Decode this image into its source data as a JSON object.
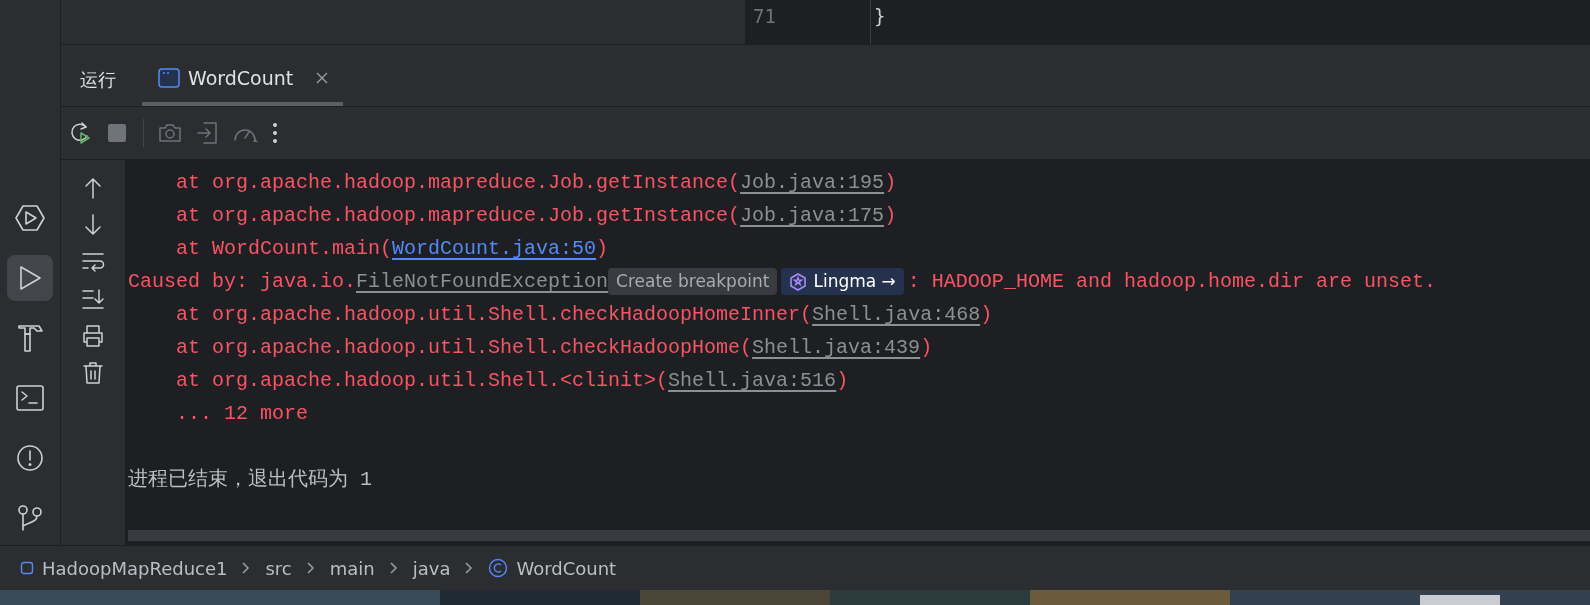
{
  "editor": {
    "line_numbers": [
      "71"
    ],
    "code_lines": [
      "}"
    ]
  },
  "sidebar": {
    "items": [
      {
        "selected": false
      },
      {
        "selected": true
      },
      {
        "selected": false
      },
      {
        "selected": false
      },
      {
        "selected": false
      },
      {
        "selected": false
      }
    ]
  },
  "run_panel": {
    "title": "运行",
    "tabs": [
      {
        "label": "WordCount",
        "selected": true
      }
    ]
  },
  "console": {
    "lines": [
      {
        "kind": "frame",
        "segments": [
          {
            "kind": "text",
            "text": "at org.apache.hadoop.mapreduce.Job.getInstance("
          },
          {
            "kind": "library_link",
            "text": "Job.java:195"
          },
          {
            "kind": "text",
            "text": ")"
          }
        ]
      },
      {
        "kind": "frame",
        "segments": [
          {
            "kind": "text",
            "text": "at org.apache.hadoop.mapreduce.Job.getInstance("
          },
          {
            "kind": "library_link",
            "text": "Job.java:175"
          },
          {
            "kind": "text",
            "text": ")"
          }
        ]
      },
      {
        "kind": "frame",
        "segments": [
          {
            "kind": "text",
            "text": "at WordCount.main("
          },
          {
            "kind": "project_link",
            "text": "WordCount.java:50"
          },
          {
            "kind": "text",
            "text": ")"
          }
        ]
      },
      {
        "kind": "cause",
        "segments": [
          {
            "kind": "text",
            "text": "Caused by: java.io."
          },
          {
            "kind": "library_link",
            "text": "FileNotFoundException"
          },
          {
            "kind": "hint_chip",
            "text": "Create breakpoint"
          },
          {
            "kind": "assistant_chip",
            "text": "Lingma",
            "arrow": "→"
          },
          {
            "kind": "text",
            "text": ": HADOOP_HOME and hadoop.home.dir are unset."
          }
        ]
      },
      {
        "kind": "frame",
        "segments": [
          {
            "kind": "text",
            "text": "at org.apache.hadoop.util.Shell.checkHadoopHomeInner("
          },
          {
            "kind": "library_link",
            "text": "Shell.java:468"
          },
          {
            "kind": "text",
            "text": ")"
          }
        ]
      },
      {
        "kind": "frame",
        "segments": [
          {
            "kind": "text",
            "text": "at org.apache.hadoop.util.Shell.checkHadoopHome("
          },
          {
            "kind": "library_link",
            "text": "Shell.java:439"
          },
          {
            "kind": "text",
            "text": ")"
          }
        ]
      },
      {
        "kind": "frame",
        "segments": [
          {
            "kind": "text",
            "text": "at org.apache.hadoop.util.Shell.<clinit>("
          },
          {
            "kind": "library_link",
            "text": "Shell.java:516"
          },
          {
            "kind": "text",
            "text": ")"
          }
        ]
      },
      {
        "kind": "frame",
        "segments": [
          {
            "kind": "text",
            "text": "... 12 more"
          }
        ]
      },
      {
        "kind": "status",
        "segments": [
          {
            "kind": "text",
            "text": "进程已结束，退出代码为 1"
          }
        ]
      }
    ]
  },
  "status_bar": {
    "breadcrumbs": [
      {
        "label": "HadoopMapReduce1",
        "kind": "module"
      },
      {
        "label": "src",
        "kind": "folder"
      },
      {
        "label": "main",
        "kind": "folder"
      },
      {
        "label": "java",
        "kind": "folder"
      },
      {
        "label": "WordCount",
        "kind": "class"
      }
    ]
  }
}
